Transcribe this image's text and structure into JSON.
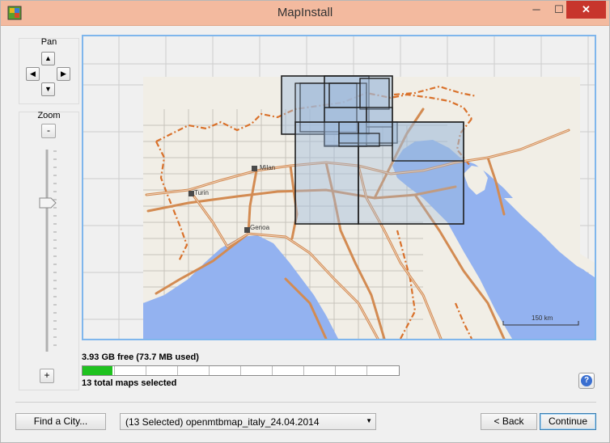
{
  "window": {
    "title": "MapInstall",
    "minimize_glyph": "─",
    "maximize_glyph": "☐",
    "close_glyph": "✕"
  },
  "pan": {
    "label": "Pan",
    "up_glyph": "▲",
    "down_glyph": "▼",
    "left_glyph": "◀",
    "right_glyph": "▶"
  },
  "zoom": {
    "label": "Zoom",
    "out_label": "-",
    "in_label": "+"
  },
  "map": {
    "cities": [
      "Milan",
      "Turin",
      "Genoa"
    ],
    "scale_label": "150 km",
    "colors": {
      "land": "#f1eee6",
      "water": "#93b2f0",
      "road": "#d38b52",
      "border": "#d9712b",
      "selected_fill": "#9fbadb",
      "selected_outline": "#1f1f1f",
      "tile_line": "#c9c9c9"
    }
  },
  "status": {
    "free_space": "3.93 GB free (73.7 MB used)",
    "maps_selected": "13 total maps selected",
    "progress_fraction": 0.019,
    "progress_color": "#1fc21f"
  },
  "help": {
    "glyph": "?"
  },
  "bottom": {
    "find_city_label": "Find a City...",
    "map_select_value": "(13 Selected) openmtbmap_italy_24.04.2014",
    "back_label": "< Back",
    "continue_label": "Continue"
  }
}
